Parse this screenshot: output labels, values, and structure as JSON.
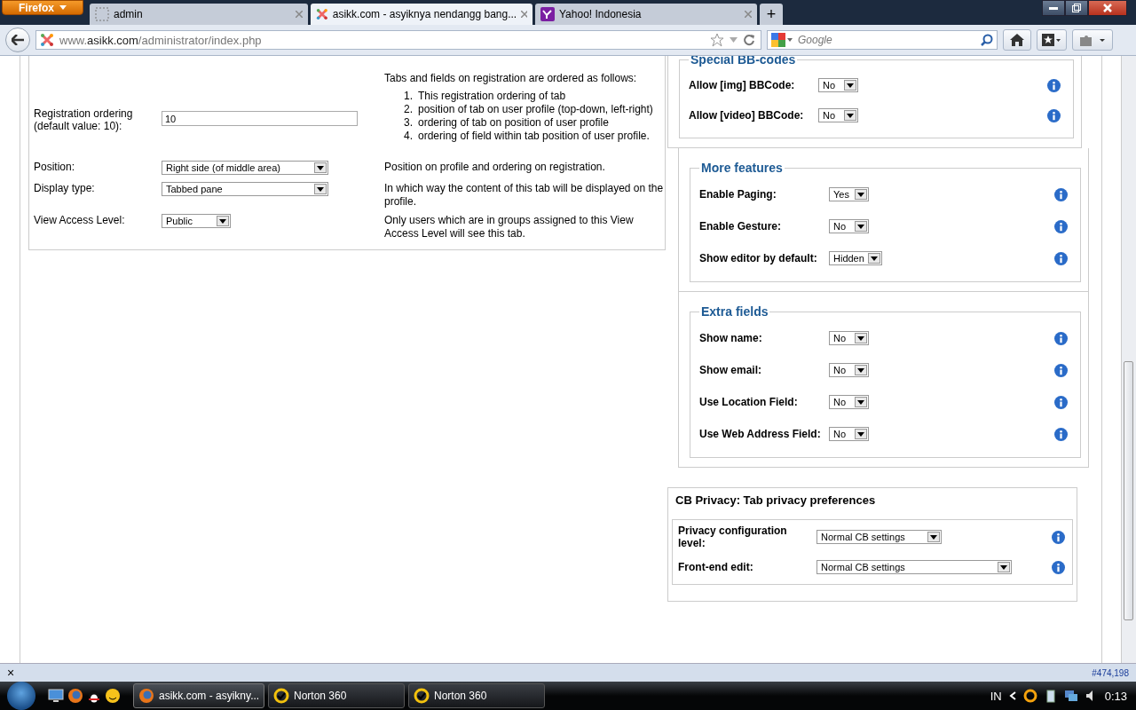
{
  "browser": {
    "menu_button": "Firefox",
    "tabs": [
      {
        "title": "admin",
        "selected": false,
        "kind": "blank"
      },
      {
        "title": "asikk.com - asyiknya nendangg bang...",
        "selected": true,
        "kind": "site"
      },
      {
        "title": "Yahoo! Indonesia",
        "selected": false,
        "kind": "yahoo"
      }
    ],
    "new_tab": "+",
    "address": {
      "prefix": "www.",
      "domain": "asikk.com",
      "path": "/administrator/index.php"
    },
    "search": {
      "placeholder": "Google"
    }
  },
  "left_form": {
    "rows": [
      {
        "kind": "input",
        "label": "Registration ordering (default value: 10):",
        "value": "10",
        "description": {
          "intro": "Tabs and fields on registration are ordered as follows:",
          "items": [
            {
              "number": "1.",
              "text": "This registration ordering of tab"
            },
            {
              "number": "2.",
              "text": "position of tab on user profile (top-down, left-right)"
            },
            {
              "number": "3.",
              "text": "ordering of tab on position of user profile"
            },
            {
              "number": "4.",
              "text": "ordering of field within tab position of user profile."
            }
          ]
        }
      },
      {
        "kind": "select",
        "label": "Position:",
        "value": "Right side (of middle area)",
        "description": {
          "intro": "Position on profile and ordering on registration."
        }
      },
      {
        "kind": "select",
        "label": "Display type:",
        "value": "Tabbed pane",
        "description": {
          "intro": "In which way the content of this tab will be displayed on the profile."
        }
      },
      {
        "kind": "select",
        "label": "View Access Level:",
        "value": "Public",
        "description": {
          "intro": "Only users which are in groups assigned to this View Access Level will see this tab."
        }
      }
    ]
  },
  "fieldsets": [
    {
      "legend": "Special BB-codes",
      "kind": "nested",
      "rows": [
        {
          "label": "Allow [img] BBCode:",
          "value": "No"
        },
        {
          "label": "Allow [video] BBCode:",
          "value": "No"
        }
      ]
    },
    {
      "legend": "More features",
      "kind": "boxed",
      "rows": [
        {
          "label": "Enable Paging:",
          "value": "Yes"
        },
        {
          "label": "Enable Gesture:",
          "value": "No"
        },
        {
          "label": "Show editor by default:",
          "value": "Hidden"
        }
      ]
    },
    {
      "legend": "Extra fields",
      "kind": "boxed",
      "rows": [
        {
          "label": "Show name:",
          "value": "No"
        },
        {
          "label": "Show email:",
          "value": "No"
        },
        {
          "label": "Use Location Field:",
          "value": "No"
        },
        {
          "label": "Use Web Address Field:",
          "value": "No"
        }
      ]
    }
  ],
  "privacy": {
    "title": "CB Privacy: Tab privacy preferences",
    "rows": [
      {
        "label": "Privacy configuration level:",
        "value": "Normal CB settings"
      },
      {
        "label": "Front-end edit:",
        "value": "Normal CB settings"
      }
    ]
  },
  "status_bar": {
    "close": "×",
    "counter": "#474,198"
  },
  "taskbar": {
    "windows": [
      {
        "title": "asikk.com - asyikny...",
        "selected": true,
        "kind": "browser"
      },
      {
        "title": "Norton 360",
        "selected": false,
        "kind": "norton"
      },
      {
        "title": "Norton 360",
        "selected": false,
        "kind": "norton"
      }
    ],
    "language": "IN",
    "clock": "0:13"
  }
}
